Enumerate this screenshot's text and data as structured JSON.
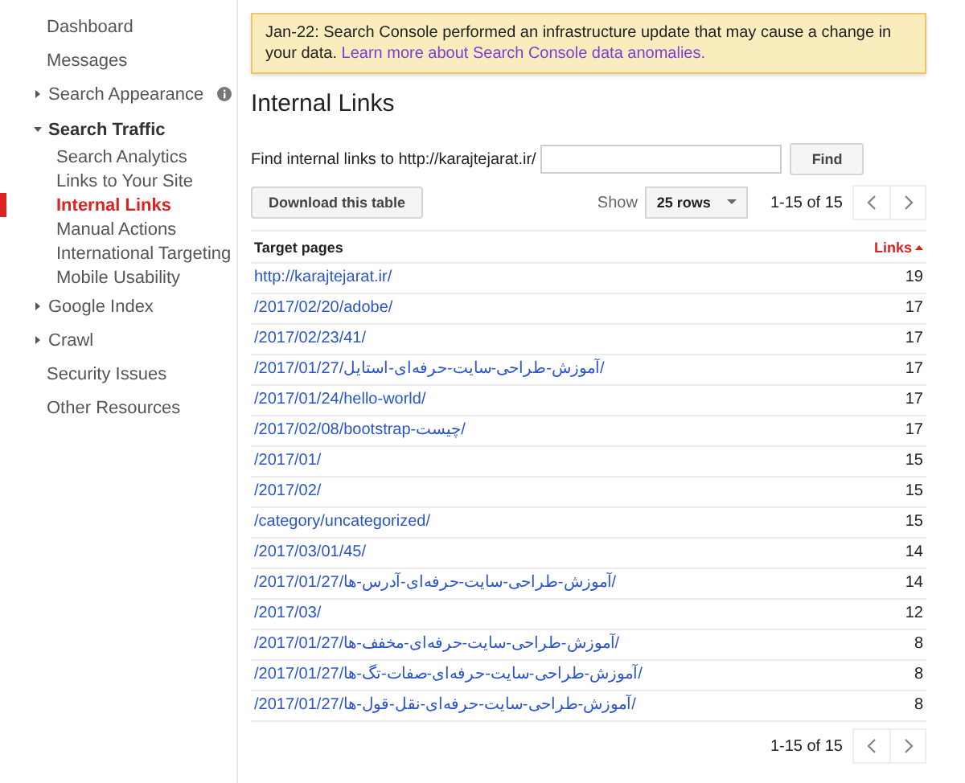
{
  "sidebar": {
    "items": [
      {
        "kind": "link",
        "label": "Dashboard",
        "selected": false
      },
      {
        "kind": "link",
        "label": "Messages",
        "selected": false
      },
      {
        "kind": "group",
        "label": "Search Appearance",
        "expanded": false,
        "info": true
      },
      {
        "kind": "group",
        "label": "Search Traffic",
        "expanded": true,
        "children": [
          {
            "label": "Search Analytics",
            "selected": false
          },
          {
            "label": "Links to Your Site",
            "selected": false
          },
          {
            "label": "Internal Links",
            "selected": true
          },
          {
            "label": "Manual Actions",
            "selected": false
          },
          {
            "label": "International Targeting",
            "selected": false
          },
          {
            "label": "Mobile Usability",
            "selected": false
          }
        ]
      },
      {
        "kind": "group",
        "label": "Google Index",
        "expanded": false
      },
      {
        "kind": "group",
        "label": "Crawl",
        "expanded": false
      },
      {
        "kind": "link",
        "label": "Security Issues",
        "selected": false
      },
      {
        "kind": "link",
        "label": "Other Resources",
        "selected": false
      }
    ]
  },
  "notice": {
    "text": "Jan-22: Search Console performed an infrastructure update that may cause a change in your data.",
    "link": "Learn more about Search Console data anomalies."
  },
  "page_title": "Internal Links",
  "find": {
    "label": "Find internal links to http://karajtejarat.ir/",
    "button": "Find"
  },
  "download_button": "Download this table",
  "show": {
    "label": "Show",
    "value": "25 rows"
  },
  "pager_top": "1-15 of 15",
  "table": {
    "columns": [
      {
        "label": "Target pages",
        "sorted": false
      },
      {
        "label": "Links",
        "sorted": true
      }
    ],
    "rows": [
      {
        "page": "http://karajtejarat.ir/",
        "links": "19"
      },
      {
        "page": "/2017/02/20/adobe/",
        "links": "17"
      },
      {
        "page": "/2017/02/23/41/",
        "links": "17"
      },
      {
        "page": "/2017/01/27/آموزش-طراحی-سایت-حرفه‌ای-استایل/",
        "links": "17"
      },
      {
        "page": "/2017/01/24/hello-world/",
        "links": "17"
      },
      {
        "page": "/2017/02/08/bootstrap-چیست/",
        "links": "17"
      },
      {
        "page": "/2017/01/",
        "links": "15"
      },
      {
        "page": "/2017/02/",
        "links": "15"
      },
      {
        "page": "/category/uncategorized/",
        "links": "15"
      },
      {
        "page": "/2017/03/01/45/",
        "links": "14"
      },
      {
        "page": "/2017/01/27/آموزش-طراحی-سایت-حرفه‌ای-آدرس-ها/",
        "links": "14"
      },
      {
        "page": "/2017/03/",
        "links": "12"
      },
      {
        "page": "/2017/01/27/آموزش-طراحی-سایت-حرفه‌ای-مخفف-ها/",
        "links": "8"
      },
      {
        "page": "/2017/01/27/آموزش-طراحی-سایت-حرفه‌ای-صفات-تگ-ها/",
        "links": "8"
      },
      {
        "page": "/2017/01/27/آموزش-طراحی-سایت-حرفه‌ای-نقل-قول-ها/",
        "links": "8"
      }
    ]
  },
  "pager_bottom": "1-15 of 15"
}
